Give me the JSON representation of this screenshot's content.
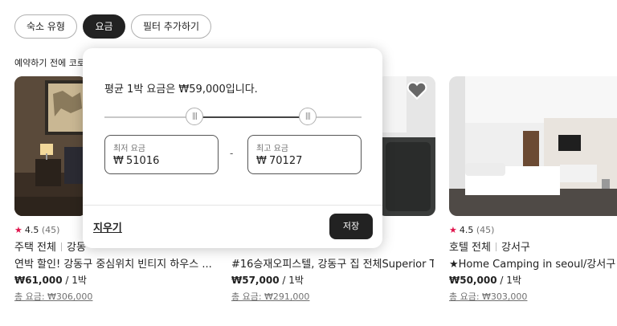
{
  "filters": {
    "chips": [
      "숙소 유형",
      "요금",
      "필터 추가하기"
    ]
  },
  "notice": "예약하기 전에 코로",
  "listings": [
    {
      "rating": "4.5",
      "reviews": "(45)",
      "type": "주택 전체",
      "location": "강동",
      "title": "연박 할인! 강동구 중심위치 빈티지 하우스 ...",
      "price": "₩61,000",
      "per": "/ 1박",
      "total": "총 요금: ₩306,000"
    },
    {
      "rating": "",
      "reviews": "",
      "type": "",
      "location": "",
      "title": "#16승재오피스텔, 강동구 집 전체Superior T...",
      "price": "₩57,000",
      "per": "/ 1박",
      "total": "총 요금: ₩291,000"
    },
    {
      "rating": "4.5",
      "reviews": "(45)",
      "type": "호텔 전체",
      "location": "강서구",
      "title": "★Home Camping in seoul/강서구 위",
      "price": "₩50,000",
      "per": "/ 1박",
      "total": "총 요금: ₩303,000"
    }
  ],
  "price_popup": {
    "average_text": "평균 1박 요금은 ₩59,000입니다.",
    "slider": {
      "min_fraction": 0.35,
      "max_fraction": 0.79
    },
    "min_field": {
      "label": "최저 요금",
      "currency": "₩",
      "value": "51016"
    },
    "separator": "-",
    "max_field": {
      "label": "최고 요금",
      "currency": "₩",
      "value": "70127"
    },
    "clear_label": "지우기",
    "save_label": "저장"
  },
  "icons": {
    "wishlist": "heart-icon",
    "rating": "star-icon",
    "slider_thumb": "grip-icon"
  },
  "colors": {
    "accent": "#222222",
    "star": "#e0144c",
    "muted": "#717171"
  }
}
